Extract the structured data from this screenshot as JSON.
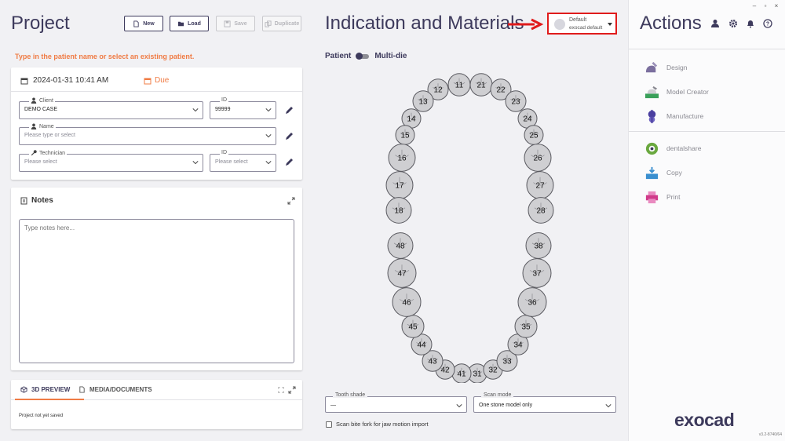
{
  "project": {
    "title": "Project",
    "buttons": {
      "new": "New",
      "load": "Load",
      "save": "Save",
      "duplicate": "Duplicate"
    },
    "hint": "Type in the patient name or select an existing patient.",
    "date": "2024-01-31 10:41 AM",
    "due_label": "Due",
    "client": {
      "label": "Client",
      "value": "DEMO CASE",
      "id_label": "ID",
      "id_value": "99999"
    },
    "name": {
      "label": "Name",
      "placeholder": "Please type or select"
    },
    "technician": {
      "label": "Technician",
      "placeholder": "Please select",
      "id_label": "ID",
      "id_placeholder": "Please select"
    },
    "notes": {
      "title": "Notes",
      "placeholder": "Type notes here..."
    },
    "preview": {
      "tab_3d": "3D PREVIEW",
      "tab_media": "MEDIA/DOCUMENTS",
      "status": "Project not yet saved"
    }
  },
  "indication": {
    "title": "Indication and Materials",
    "preset": {
      "line1": "Default",
      "line2": "exocad default"
    },
    "toggle": {
      "left": "Patient",
      "right": "Multi-die"
    },
    "teeth_upper": [
      "11",
      "12",
      "13",
      "14",
      "15",
      "16",
      "17",
      "18",
      "21",
      "22",
      "23",
      "24",
      "25",
      "26",
      "27",
      "28"
    ],
    "teeth_lower": [
      "31",
      "32",
      "33",
      "34",
      "35",
      "36",
      "37",
      "38",
      "41",
      "42",
      "43",
      "44",
      "45",
      "46",
      "47",
      "48"
    ],
    "tooth_shade": {
      "label": "Tooth shade",
      "value": "—"
    },
    "scan_mode": {
      "label": "Scan mode",
      "value": "One stone model only"
    },
    "bite_fork": "Scan bite fork for jaw motion import"
  },
  "actions": {
    "title": "Actions",
    "items": [
      {
        "label": "Design",
        "icon": "design-icon",
        "color": "#7b6f9e"
      },
      {
        "label": "Model Creator",
        "icon": "model-creator-icon",
        "color": "#3aa05a"
      },
      {
        "label": "Manufacture",
        "icon": "manufacture-icon",
        "color": "#4a3fa0"
      },
      {
        "label": "dentalshare",
        "icon": "dentalshare-icon",
        "color": "#6aa83f"
      },
      {
        "label": "Copy",
        "icon": "copy-icon",
        "color": "#3a8fcf"
      },
      {
        "label": "Print",
        "icon": "print-icon",
        "color": "#d03a8a"
      }
    ],
    "logo": "exocad",
    "version": "v3.2-8740/64"
  },
  "colors": {
    "accent": "#f07c45",
    "primary": "#3d3a5c",
    "highlight": "#e01b1b"
  }
}
